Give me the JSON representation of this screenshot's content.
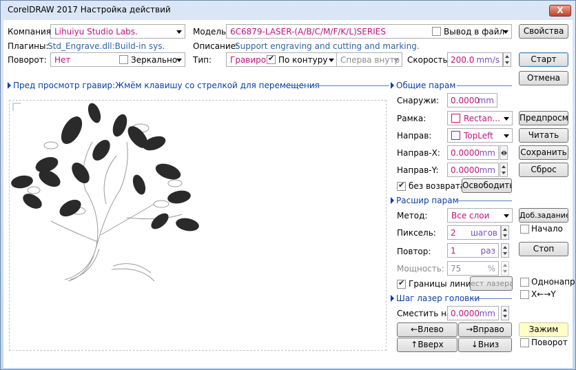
{
  "window": {
    "title": "CorelDRAW 2017 Настройка действий",
    "close": "X"
  },
  "company": {
    "label": "Компания:",
    "value": "Lihuiyu Studio Labs."
  },
  "model": {
    "label": "Модель:",
    "value": "6C6879-LASER-(A/B/C/M/F/K/L)SERIES",
    "output_to_file": "Вывод в файл"
  },
  "plugins": {
    "label": "Плагины:",
    "value": "Std_Engrave.dll:Build-in sys."
  },
  "description": {
    "label": "Описание:",
    "value": "Support engraving and cutting and marking."
  },
  "rotation": {
    "label": "Поворот:",
    "value": "Нет",
    "mirror": "Зеркально"
  },
  "type": {
    "label": "Тип:",
    "value": "Гравиров",
    "contour": "По контуру",
    "order": "Сперва внутр"
  },
  "speed": {
    "label": "Скорость:",
    "value": "200.0",
    "unit": "mm/s"
  },
  "preview": {
    "header": "Пред просмотр гравир:Жмём клавишу со стрелкой для перемещения"
  },
  "general": {
    "header": "Общие парам",
    "outside": {
      "label": "Снаружи:",
      "value": "0.0000",
      "unit": "mm"
    },
    "frame": {
      "label": "Рамка:",
      "value": "Rectan..."
    },
    "direction": {
      "label": "Направ:",
      "value": "TopLeft"
    },
    "dir_x": {
      "label": "Направ-X:",
      "value": "0.0000",
      "unit": "mm"
    },
    "dir_y": {
      "label": "Направ-Y:",
      "value": "0.0000",
      "unit": "mm"
    },
    "no_return": "без возврата",
    "release": "Освободить"
  },
  "extended": {
    "header": "Расшир парам",
    "method": {
      "label": "Метод:",
      "value": "Все слои"
    },
    "pixel": {
      "label": "Пиксель:",
      "value": "2",
      "unit": "шагов"
    },
    "repeat": {
      "label": "Повтор:",
      "value": "1",
      "unit": "раз"
    },
    "power": {
      "label": "Мощность:",
      "value": "75",
      "unit": "%"
    },
    "boundaries": "Границы линии",
    "laser_test": "ест лазера"
  },
  "step": {
    "header": "Шаг лазер головки",
    "shift": {
      "label": "Сместить на:",
      "value": "0.0000",
      "unit": "mm"
    },
    "left": "←Влево",
    "right": "→Вправо",
    "up": "↑Вверх",
    "down": "↓Вниз"
  },
  "right_buttons": {
    "properties": "Свойства",
    "start": "Старт",
    "cancel": "Отмена",
    "preview": "Предпросм",
    "read": "Читать",
    "save": "Сохранить",
    "reset": "Сброс",
    "add_task": "Доб.задание",
    "begin": "Начало",
    "stop": "Стоп",
    "one_dir": "Однонапр",
    "xy": "X←→Y",
    "clamp": "Зажим",
    "rotate": "Поворот"
  }
}
